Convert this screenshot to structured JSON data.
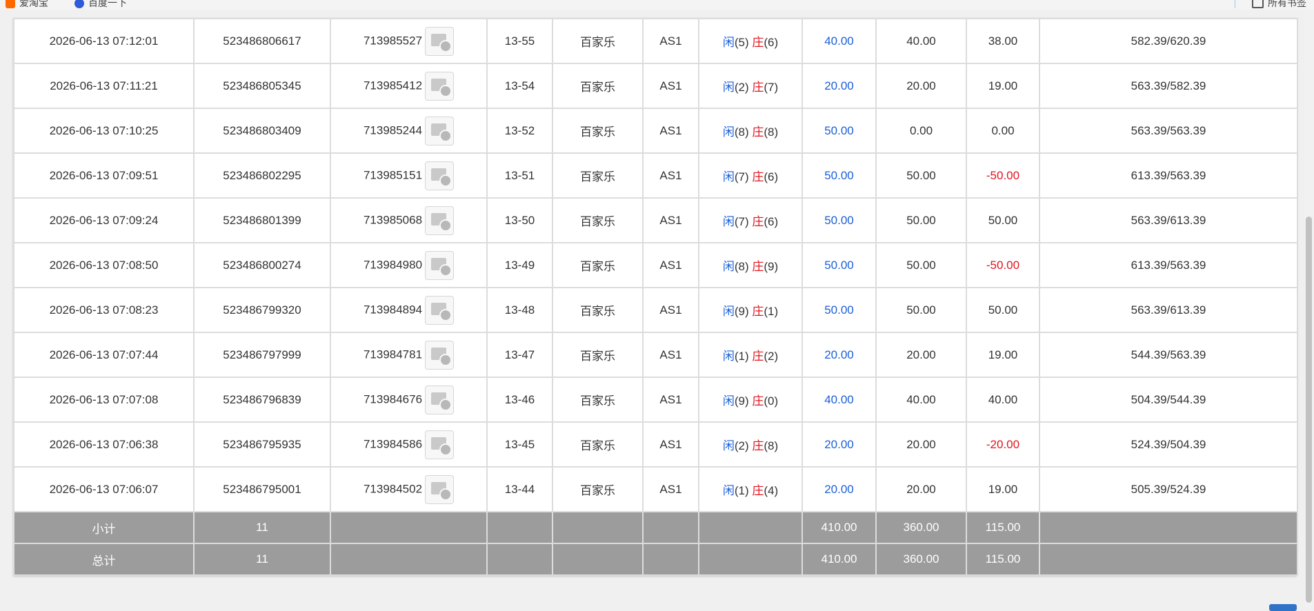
{
  "bookmarks": {
    "items": [
      {
        "label": "爱淘宝",
        "icon": "taobao-icon"
      },
      {
        "label": "百度一下",
        "icon": "baidu-icon"
      },
      {
        "label": "所有书签",
        "icon": "folder-icon"
      }
    ]
  },
  "table": {
    "rows": [
      {
        "time": "2026-06-13 07:12:01",
        "order": "523486806617",
        "round": "713985527",
        "table": "13-55",
        "game": "百家乐",
        "hall": "AS1",
        "player_label": "闲",
        "player_score": "(5)",
        "banker_label": "庄",
        "banker_score": "(6)",
        "bet": "40.00",
        "valid": "40.00",
        "result": "38.00",
        "result_color": "normal",
        "balance": "582.39/620.39"
      },
      {
        "time": "2026-06-13 07:11:21",
        "order": "523486805345",
        "round": "713985412",
        "table": "13-54",
        "game": "百家乐",
        "hall": "AS1",
        "player_label": "闲",
        "player_score": "(2)",
        "banker_label": "庄",
        "banker_score": "(7)",
        "bet": "20.00",
        "valid": "20.00",
        "result": "19.00",
        "result_color": "normal",
        "balance": "563.39/582.39"
      },
      {
        "time": "2026-06-13 07:10:25",
        "order": "523486803409",
        "round": "713985244",
        "table": "13-52",
        "game": "百家乐",
        "hall": "AS1",
        "player_label": "闲",
        "player_score": "(8)",
        "banker_label": "庄",
        "banker_score": "(8)",
        "bet": "50.00",
        "valid": "0.00",
        "result": "0.00",
        "result_color": "normal",
        "balance": "563.39/563.39"
      },
      {
        "time": "2026-06-13 07:09:51",
        "order": "523486802295",
        "round": "713985151",
        "table": "13-51",
        "game": "百家乐",
        "hall": "AS1",
        "player_label": "闲",
        "player_score": "(7)",
        "banker_label": "庄",
        "banker_score": "(6)",
        "bet": "50.00",
        "valid": "50.00",
        "result": "-50.00",
        "result_color": "negative",
        "balance": "613.39/563.39"
      },
      {
        "time": "2026-06-13 07:09:24",
        "order": "523486801399",
        "round": "713985068",
        "table": "13-50",
        "game": "百家乐",
        "hall": "AS1",
        "player_label": "闲",
        "player_score": "(7)",
        "banker_label": "庄",
        "banker_score": "(6)",
        "bet": "50.00",
        "valid": "50.00",
        "result": "50.00",
        "result_color": "normal",
        "balance": "563.39/613.39"
      },
      {
        "time": "2026-06-13 07:08:50",
        "order": "523486800274",
        "round": "713984980",
        "table": "13-49",
        "game": "百家乐",
        "hall": "AS1",
        "player_label": "闲",
        "player_score": "(8)",
        "banker_label": "庄",
        "banker_score": "(9)",
        "bet": "50.00",
        "valid": "50.00",
        "result": "-50.00",
        "result_color": "negative",
        "balance": "613.39/563.39"
      },
      {
        "time": "2026-06-13 07:08:23",
        "order": "523486799320",
        "round": "713984894",
        "table": "13-48",
        "game": "百家乐",
        "hall": "AS1",
        "player_label": "闲",
        "player_score": "(9)",
        "banker_label": "庄",
        "banker_score": "(1)",
        "bet": "50.00",
        "valid": "50.00",
        "result": "50.00",
        "result_color": "normal",
        "balance": "563.39/613.39"
      },
      {
        "time": "2026-06-13 07:07:44",
        "order": "523486797999",
        "round": "713984781",
        "table": "13-47",
        "game": "百家乐",
        "hall": "AS1",
        "player_label": "闲",
        "player_score": "(1)",
        "banker_label": "庄",
        "banker_score": "(2)",
        "bet": "20.00",
        "valid": "20.00",
        "result": "19.00",
        "result_color": "normal",
        "balance": "544.39/563.39"
      },
      {
        "time": "2026-06-13 07:07:08",
        "order": "523486796839",
        "round": "713984676",
        "table": "13-46",
        "game": "百家乐",
        "hall": "AS1",
        "player_label": "闲",
        "player_score": "(9)",
        "banker_label": "庄",
        "banker_score": "(0)",
        "bet": "40.00",
        "valid": "40.00",
        "result": "40.00",
        "result_color": "normal",
        "balance": "504.39/544.39"
      },
      {
        "time": "2026-06-13 07:06:38",
        "order": "523486795935",
        "round": "713984586",
        "table": "13-45",
        "game": "百家乐",
        "hall": "AS1",
        "player_label": "闲",
        "player_score": "(2)",
        "banker_label": "庄",
        "banker_score": "(8)",
        "bet": "20.00",
        "valid": "20.00",
        "result": "-20.00",
        "result_color": "negative",
        "balance": "524.39/504.39"
      },
      {
        "time": "2026-06-13 07:06:07",
        "order": "523486795001",
        "round": "713984502",
        "table": "13-44",
        "game": "百家乐",
        "hall": "AS1",
        "player_label": "闲",
        "player_score": "(1)",
        "banker_label": "庄",
        "banker_score": "(4)",
        "bet": "20.00",
        "valid": "20.00",
        "result": "19.00",
        "result_color": "normal",
        "balance": "505.39/524.39"
      }
    ],
    "subtotal": {
      "label": "小计",
      "count": "11",
      "bet": "410.00",
      "valid": "360.00",
      "result": "115.00"
    },
    "total": {
      "label": "总计",
      "count": "11",
      "bet": "410.00",
      "valid": "360.00",
      "result": "115.00"
    }
  },
  "colors": {
    "player": "#1a5fd8",
    "banker": "#e0141e",
    "bet_amount": "#1a5fd8",
    "negative": "#e0141e",
    "summary_bg": "#9c9c9c"
  }
}
